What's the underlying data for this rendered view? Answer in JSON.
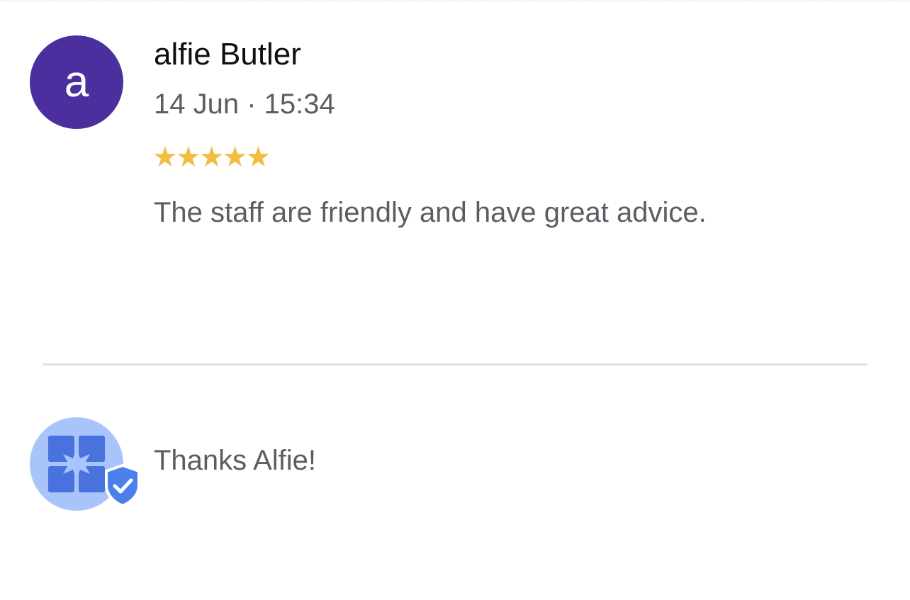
{
  "review": {
    "avatar_letter": "a",
    "reviewer_name": "alfie Butler",
    "date": "14 Jun · 15:34",
    "rating": 5,
    "rating_stars": "★★★★★",
    "text": "The staff are friendly and have great advice."
  },
  "reply": {
    "avatar_icon": "business-logo-icon",
    "badge_icon": "verified-shield-icon",
    "text": "Thanks Alfie!"
  },
  "colors": {
    "avatar_bg": "#4b2f9e",
    "star": "#f2bd42",
    "reply_avatar_bg": "#a9c3fb",
    "reply_logo": "#4a72de",
    "badge": "#4b7fec"
  }
}
